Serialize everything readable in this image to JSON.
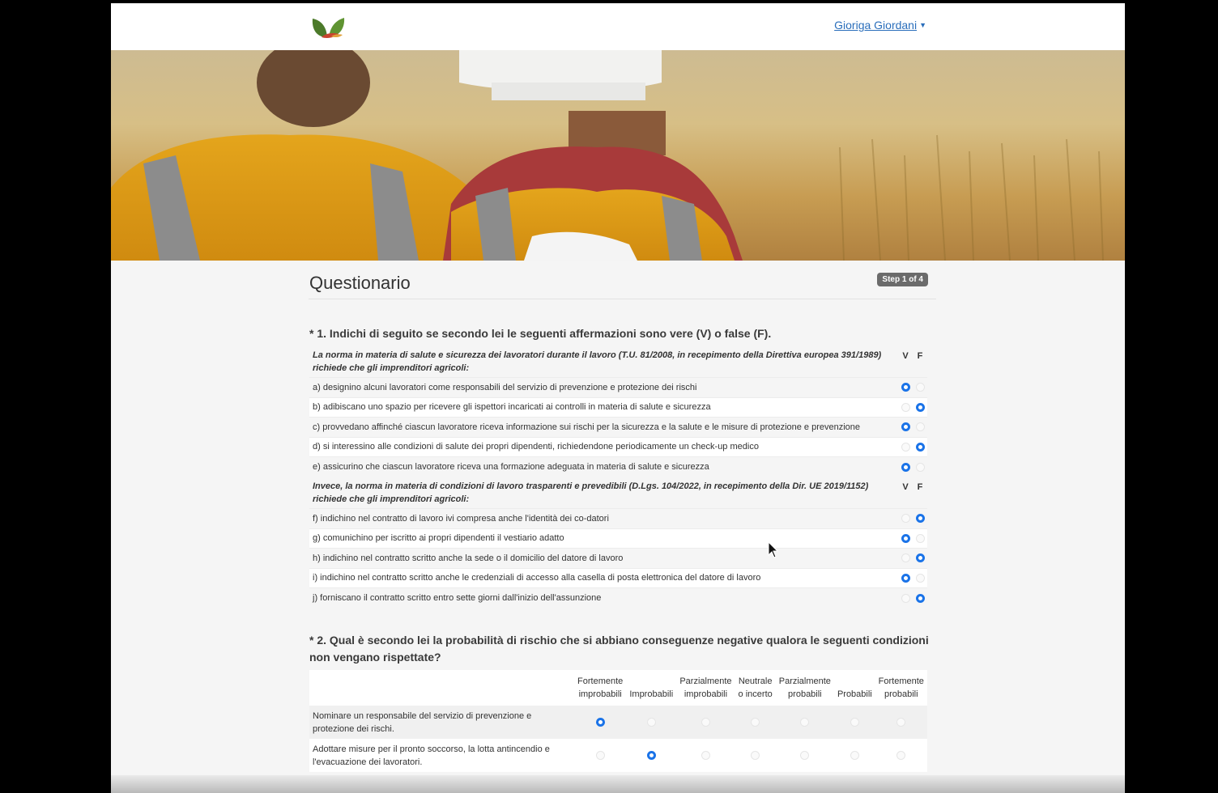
{
  "navbar": {
    "logo": "leaf-logo-icon",
    "user_name": "Gioriga Giordani"
  },
  "page": {
    "title": "Questionario",
    "step_badge": "Step 1 of 4"
  },
  "q1": {
    "title": "* 1. Indichi di seguito se secondo lei le seguenti affermazioni sono vere (V) o false (F).",
    "col_v": "V",
    "col_f": "F",
    "sections": [
      {
        "header": "La norma in materia di salute e sicurezza dei lavoratori durante il lavoro (T.U. 81/2008, in recepimento della Direttiva europea 391/1989) richiede che gli imprenditori agricoli:",
        "items": [
          {
            "text": "a) designino alcuni lavoratori come responsabili del servizio di prevenzione e protezione dei rischi",
            "answer": "V"
          },
          {
            "text": "b) adibiscano uno spazio per ricevere gli ispettori incaricati ai controlli in materia di salute e sicurezza",
            "answer": "F"
          },
          {
            "text": "c) provvedano affinché ciascun lavoratore riceva informazione sui rischi per la sicurezza e la salute e le misure di protezione e prevenzione",
            "answer": "V"
          },
          {
            "text": "d) si interessino alle condizioni di salute dei propri dipendenti, richiedendone periodicamente un check-up medico",
            "answer": "F"
          },
          {
            "text": "e) assicurino che ciascun lavoratore riceva una formazione adeguata in materia di salute e sicurezza",
            "answer": "V"
          }
        ]
      },
      {
        "header": "Invece, la norma in materia di condizioni di lavoro trasparenti e prevedibili (D.Lgs. 104/2022, in recepimento della Dir. UE 2019/1152) richiede che gli imprenditori agricoli:",
        "items": [
          {
            "text": "f) indichino nel contratto di lavoro ivi compresa anche l'identità dei co-datori",
            "answer": "F"
          },
          {
            "text": "g) comunichino per iscritto ai propri dipendenti il vestiario adatto",
            "answer": "V"
          },
          {
            "text": "h) indichino nel contratto scritto anche la sede o il domicilio del datore di lavoro",
            "answer": "F"
          },
          {
            "text": "i) indichino nel contratto scritto anche le credenziali di accesso alla casella di posta elettronica del datore di lavoro",
            "answer": "V"
          },
          {
            "text": "j) forniscano il contratto scritto entro sette giorni dall'inizio dell'assunzione",
            "answer": "F"
          }
        ]
      }
    ]
  },
  "q2": {
    "title": "* 2. Qual è secondo lei la probabilità di rischio che si abbiano conseguenze negative qualora le seguenti condizioni non vengano rispettate?",
    "columns": [
      [
        "Fortemente",
        "improbabili"
      ],
      [
        "",
        "Improbabili"
      ],
      [
        "Parzialmente",
        "improbabili"
      ],
      [
        "Neutrale",
        "o incerto"
      ],
      [
        "Parzialmente",
        "probabili"
      ],
      [
        "",
        "Probabili"
      ],
      [
        "Fortemente",
        "probabili"
      ]
    ],
    "rows": [
      {
        "text": "Nominare un responsabile del servizio di prevenzione e protezione dei rischi.",
        "selected": 0
      },
      {
        "text": "Adottare misure per il pronto soccorso, la lotta antincendio e l'evacuazione dei lavoratori.",
        "selected": 1
      }
    ]
  }
}
